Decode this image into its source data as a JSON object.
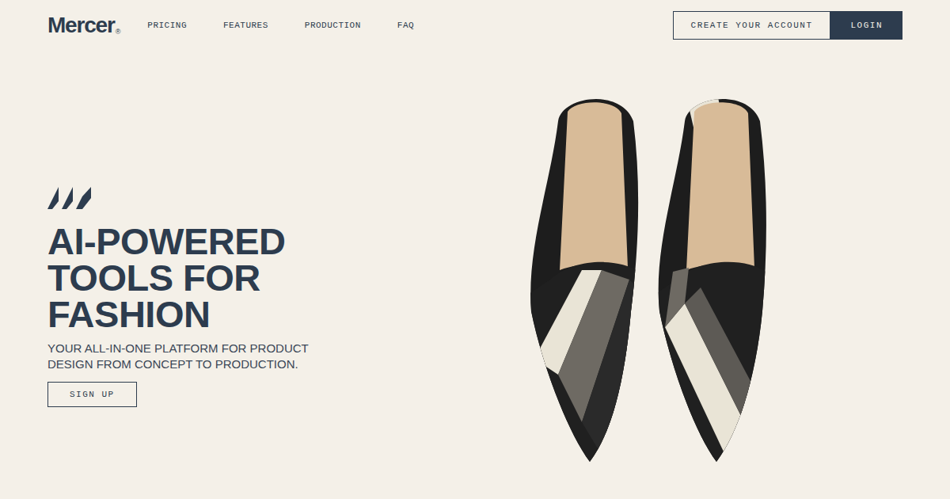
{
  "logo": {
    "name": "Mercer",
    "mark": "®"
  },
  "nav": [
    {
      "label": "PRICING"
    },
    {
      "label": "FEATURES"
    },
    {
      "label": "PRODUCTION"
    },
    {
      "label": "FAQ"
    }
  ],
  "header_buttons": {
    "create_account": "CREATE YOUR ACCOUNT",
    "login": "LOGIN"
  },
  "hero": {
    "headline_lines": [
      "AI-POWERED",
      "TOOLS FOR",
      "FASHION"
    ],
    "subtitle": "YOUR ALL-IN-ONE PLATFORM FOR PRODUCT DESIGN FROM CONCEPT TO PRODUCTION.",
    "cta": "SIGN UP"
  }
}
